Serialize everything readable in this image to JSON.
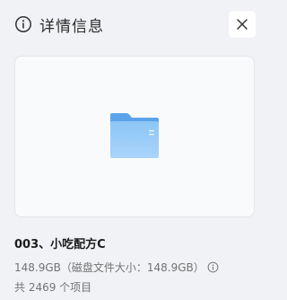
{
  "header": {
    "title": "详情信息",
    "title_icon": "info-icon",
    "close_icon": "close-icon"
  },
  "preview": {
    "icon": "folder-icon",
    "folder_color": "#6aaeee"
  },
  "file": {
    "name": "003、小吃配方C",
    "size_text": "148.9GB（磁盘文件大小：148.9GB）",
    "size_info_icon": "info-icon",
    "count_text": "共 2469 个项目"
  }
}
